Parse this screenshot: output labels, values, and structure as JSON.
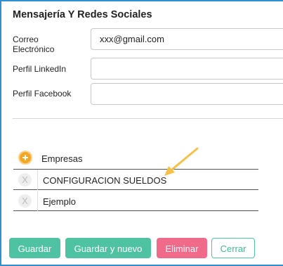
{
  "section": {
    "title": "Mensajería Y Redes Sociales"
  },
  "fields": {
    "email": {
      "label_line1": "Correo",
      "label_line2": "Electrónico",
      "value": "xxx@gmail.com"
    },
    "linkedin": {
      "label": "Perfil LinkedIn",
      "value": ""
    },
    "facebook": {
      "label": "Perfil Facebook",
      "value": ""
    }
  },
  "groups": {
    "label": "Empresas",
    "items": [
      {
        "label": "CONFIGURACION SUELDOS",
        "remove": "X"
      },
      {
        "label": "Ejemplo",
        "remove": "X"
      }
    ]
  },
  "buttons": {
    "save": "Guardar",
    "save_new": "Guardar y nuevo",
    "delete": "Eliminar",
    "cancel": "Cerrar"
  },
  "colors": {
    "accent_green": "#4fc3a1",
    "delete_pink": "#f06a8a",
    "add_orange": "#f5a623",
    "arrow_yellow": "#f5c04a"
  }
}
